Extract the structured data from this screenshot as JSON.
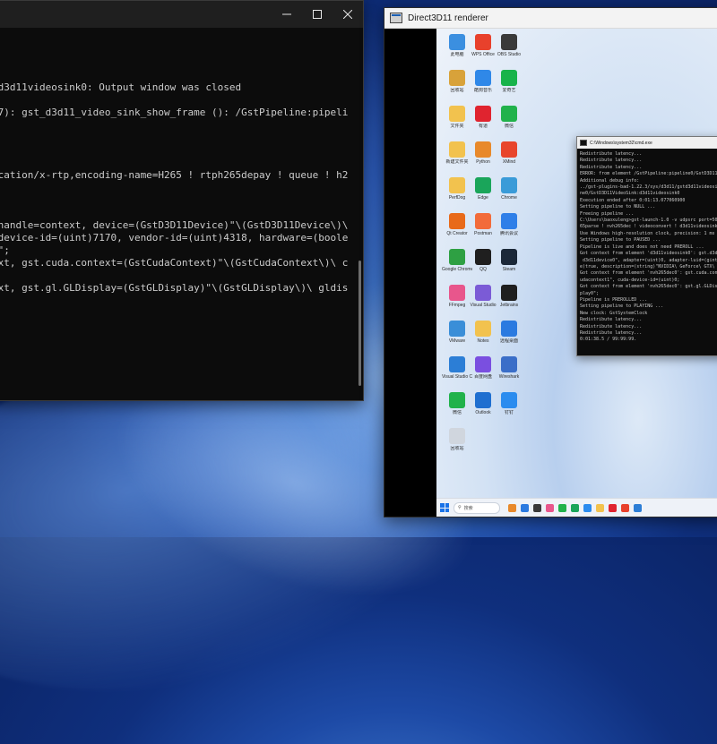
{
  "terminal": {
    "controls": [
      "minimize",
      "maximize",
      "close"
    ],
    "lines": [
      "",
      ":d3d11videosink0: Output window was closed",
      "",
      "37): gst_d3d11_video_sink_show_frame (): /GstPipeline:pipeli",
      "",
      "",
      "",
      "",
      "ication/x-rtp,encoding-name=H265 ! rtph265depay ! queue ! h2",
      "",
      "",
      "",
      ".handle=context, device=(GstD3D11Device)\"\\(GstD3D11Device\\)\\",
      " device-id=(uint)7170, vendor-id=(uint)4318, hardware=(boole",
      "B\";",
      "ext, gst.cuda.context=(GstCudaContext)\"\\(GstCudaContext\\)\\ c",
      "",
      "ext, gst.gl.GLDisplay=(GstGLDisplay)\"\\(GstGLDisplay\\)\\ gldis"
    ]
  },
  "renderer": {
    "title": "Direct3D11 renderer",
    "desktop_icons": [
      {
        "label": "此电脑",
        "color": "#3b8fe0"
      },
      {
        "label": "WPS Office",
        "color": "#e8412c"
      },
      {
        "label": "OBS Studio",
        "color": "#3a3a3a"
      },
      {
        "label": "回收站",
        "color": "#d8a23a"
      },
      {
        "label": "酷狗音乐",
        "color": "#2f88e8"
      },
      {
        "label": "爱奇艺",
        "color": "#18b34a"
      },
      {
        "label": "文件夹",
        "color": "#f2c24e"
      },
      {
        "label": "有道",
        "color": "#e0242f"
      },
      {
        "label": "微信",
        "color": "#21b24b"
      },
      {
        "label": "新建文件夹",
        "color": "#f2c24e"
      },
      {
        "label": "Python",
        "color": "#e8892b"
      },
      {
        "label": "XMind",
        "color": "#e8452c"
      },
      {
        "label": "PerfDog",
        "color": "#f2c24e"
      },
      {
        "label": "Edge",
        "color": "#1aa55a"
      },
      {
        "label": "Chrome",
        "color": "#3a9bd8"
      },
      {
        "label": "Qt Creator",
        "color": "#e86a1a"
      },
      {
        "label": "Postman",
        "color": "#f26b3a"
      },
      {
        "label": "腾讯会议",
        "color": "#2f7fe8"
      },
      {
        "label": "Google Chrome",
        "color": "#2ea043"
      },
      {
        "label": "QQ",
        "color": "#1f1f1f"
      },
      {
        "label": "Steam",
        "color": "#1b2838"
      },
      {
        "label": "FFmpeg",
        "color": "#e8568c"
      },
      {
        "label": "Visual Studio",
        "color": "#7b5bd6"
      },
      {
        "label": "Jetbrains",
        "color": "#1f1f1f"
      },
      {
        "label": "VMware",
        "color": "#3a8ed8"
      },
      {
        "label": "Notes",
        "color": "#f2c24e"
      },
      {
        "label": "远程桌面",
        "color": "#2b7ae0"
      },
      {
        "label": "Visual Studio Code",
        "color": "#2c7ed6"
      },
      {
        "label": "百度网盘",
        "color": "#7a4fe0"
      },
      {
        "label": "Wireshark",
        "color": "#3a6ec8"
      },
      {
        "label": "微信",
        "color": "#21b24b"
      },
      {
        "label": "Outlook",
        "color": "#1f6fd0"
      },
      {
        "label": "钉钉",
        "color": "#2b8cef"
      },
      {
        "label": "回收站",
        "color": "#d0d6de"
      }
    ],
    "cmd_title": "C:\\Windows\\system32\\cmd.exe",
    "cmd_lines": [
      "Redistribute latency...",
      "Redistribute latency...",
      "Redistribute latency...",
      "ERROR: from element /GstPipeline:pipeline0/GstD3D11VideoSink:d",
      "Additional debug info:",
      "../gst-plugins-bad-1.22.3/sys/d3d11/gstd3d11videosink.cpp(1437",
      "ne0/GstD3D11VideoSink:d3d11videosink0",
      "Execution ended after 0:01:13.077060900",
      "Setting pipeline to NULL ...",
      "Freeing pipeline ...",
      "",
      "C:\\Users\\baoxuleng>gst-launch-1.0 -v udpsrc port=5002 ! applica",
      "65parse ! nvh265dec ! videoconvert ! d3d11videosink",
      "Use Windows high-resolution clock, precision: 1 ms",
      "Setting pipeline to PAUSED ...",
      "Pipeline is live and does not need PREROLL ...",
      "Got context from element 'd3d11videosink0': gst.d3d11.device.ha",
      " d3d11device0\", adapter=(uint)0, adapter-luid=(gint64)66608, d",
      "e)true, description=(string)\"NVIDIA\\ GeForce\\ GTX\\ 1060\\ 3GB\"",
      "Got context from element 'nvh265dec0': gst.cuda.context=(GstCud",
      "udacontext1\", cuda-device-id=(uint)0;",
      "Got context from element 'nvh265dec0': gst.gl.GLDisplay=(GstGLD",
      "play0\";",
      "Pipeline is PREROLLED ...",
      "Setting pipeline to PLAYING ...",
      "New clock: GstSystemClock",
      "Redistribute latency...",
      "Redistribute latency...",
      "Redistribute latency...",
      "0:01:38.5 / 99:99:99."
    ],
    "taskbar": {
      "search_label": "搜索",
      "apps": [
        "#e8892b",
        "#2b7ae0",
        "#3a3a3a",
        "#e8568c",
        "#21b24b",
        "#1aa55a",
        "#2b8cef",
        "#f2c24e",
        "#e0242f",
        "#e8412c",
        "#2c7ed6"
      ]
    }
  }
}
